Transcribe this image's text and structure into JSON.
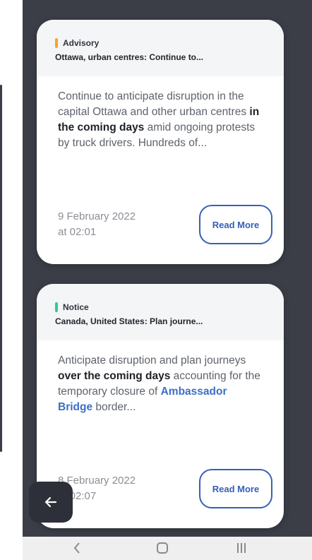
{
  "alerts": [
    {
      "type": "Advisory",
      "type_color": "#f5a623",
      "location": "Ottawa, urban centres: Continue to...",
      "body": {
        "p1": "Continue to anticipate disruption in the capital Ottawa and other urban centres ",
        "b1": "in the coming days",
        "p2": " amid ongoing protests by truck drivers. Hundreds of..."
      },
      "date_line1": "9 February 2022",
      "date_line2": "at 02:01",
      "button": "Read More"
    },
    {
      "type": "Notice",
      "type_color": "#2ec9a0",
      "location": "Canada, United States: Plan journe...",
      "body": {
        "p1": "Anticipate disruption and plan journeys ",
        "b1": "over the coming days",
        "p2": " accounting for the temporary closure of ",
        "link": "Ambassador Bridge",
        "p3": " border..."
      },
      "date_line1": "8 February 2022",
      "date_line2": "at 02:07",
      "button": "Read More"
    }
  ],
  "icons": {
    "back": "arrow-left-icon",
    "nav_back": "chevron-left-icon",
    "nav_home": "home-square-icon",
    "nav_recents": "recents-icon"
  },
  "colors": {
    "background": "#3b3e47",
    "card": "#ffffff",
    "accent": "#3560b7"
  }
}
